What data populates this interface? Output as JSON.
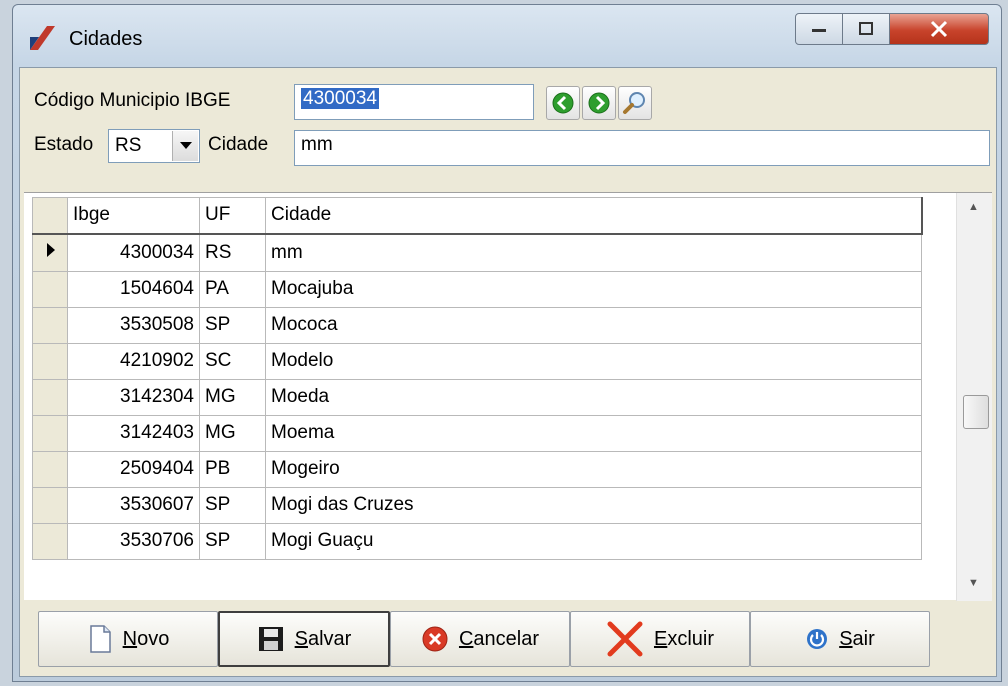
{
  "window": {
    "title": "Cidades"
  },
  "form": {
    "ibge_label": "Código Municipio IBGE",
    "ibge_value": "4300034",
    "estado_label": "Estado",
    "estado_value": "RS",
    "cidade_label": "Cidade",
    "cidade_value": "mm"
  },
  "grid": {
    "columns": [
      "Ibge",
      "UF",
      "Cidade"
    ],
    "rows": [
      {
        "ibge": "4300034",
        "uf": "RS",
        "cidade": "mm",
        "current": true
      },
      {
        "ibge": "1504604",
        "uf": "PA",
        "cidade": "Mocajuba"
      },
      {
        "ibge": "3530508",
        "uf": "SP",
        "cidade": "Mococa"
      },
      {
        "ibge": "4210902",
        "uf": "SC",
        "cidade": "Modelo"
      },
      {
        "ibge": "3142304",
        "uf": "MG",
        "cidade": "Moeda"
      },
      {
        "ibge": "3142403",
        "uf": "MG",
        "cidade": "Moema"
      },
      {
        "ibge": "2509404",
        "uf": "PB",
        "cidade": "Mogeiro"
      },
      {
        "ibge": "3530607",
        "uf": "SP",
        "cidade": "Mogi das Cruzes"
      },
      {
        "ibge": "3530706",
        "uf": "SP",
        "cidade": "Mogi Guaçu"
      }
    ]
  },
  "buttons": {
    "novo": "Novo",
    "salvar": "Salvar",
    "cancelar": "Cancelar",
    "excluir": "Excluir",
    "sair": "Sair"
  },
  "icons": {
    "app": "app-logo-icon",
    "prev": "green-arrow-left-icon",
    "next": "green-arrow-right-icon",
    "search": "magnifier-icon"
  },
  "colors": {
    "selection": "#316ac5",
    "close_button": "#c8432b",
    "nav_green": "#2e9e2e"
  }
}
